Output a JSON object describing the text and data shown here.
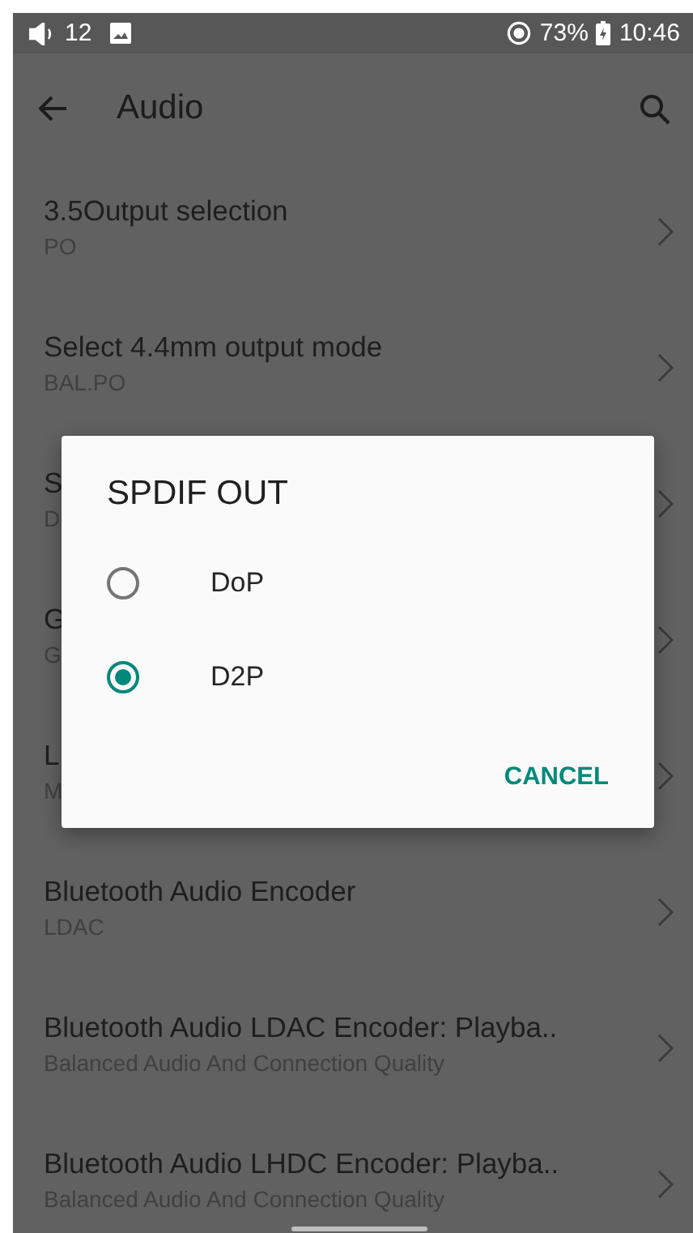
{
  "status_bar": {
    "volume": "12",
    "battery": "73%",
    "time": "10:46"
  },
  "toolbar": {
    "title": "Audio"
  },
  "settings": [
    {
      "title": "3.5Output selection",
      "subtitle": "PO"
    },
    {
      "title": "Select 4.4mm output mode",
      "subtitle": "BAL.PO"
    },
    {
      "title": "S",
      "subtitle": "D"
    },
    {
      "title": "G",
      "subtitle": "G"
    },
    {
      "title": "L",
      "subtitle": "M"
    },
    {
      "title": "Bluetooth Audio Encoder",
      "subtitle": "LDAC"
    },
    {
      "title": "Bluetooth Audio LDAC Encoder: Playba..",
      "subtitle": "Balanced Audio And Connection Quality"
    },
    {
      "title": "Bluetooth Audio LHDC Encoder: Playba..",
      "subtitle": "Balanced Audio And Connection Quality"
    }
  ],
  "dialog": {
    "title": "SPDIF OUT",
    "options": [
      {
        "label": "DoP",
        "selected": false
      },
      {
        "label": "D2P",
        "selected": true
      }
    ],
    "button": "CANCEL"
  }
}
